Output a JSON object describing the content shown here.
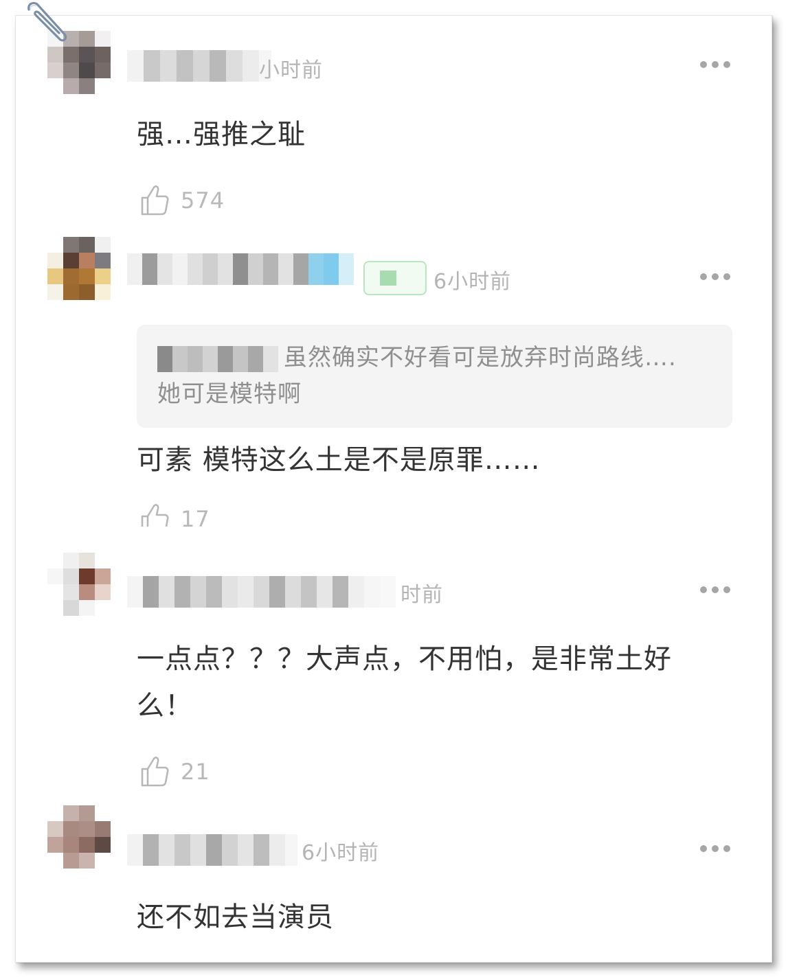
{
  "comments": [
    {
      "time": "小时前",
      "text": "强…强推之耻",
      "likes": "574"
    },
    {
      "time": "6小时前",
      "quote_text": "虽然确实不好看可是放弃时尚路线….她可是模特啊",
      "text": "可素 模特这么土是不是原罪……",
      "likes": "17"
    },
    {
      "time": "时前",
      "text_line1": "一点点？？？大声点，不用怕，是非常土好",
      "text_line2": "么！",
      "likes": "21"
    },
    {
      "time": "6小时前",
      "text": "还不如去当演员"
    }
  ],
  "icons": {
    "like": "thumbs-up-icon",
    "more": "more-dots-icon",
    "clip": "paperclip-icon"
  },
  "colors": {
    "text": "#333333",
    "meta": "#b4b4b4",
    "quote_bg": "#f4f4f4"
  }
}
